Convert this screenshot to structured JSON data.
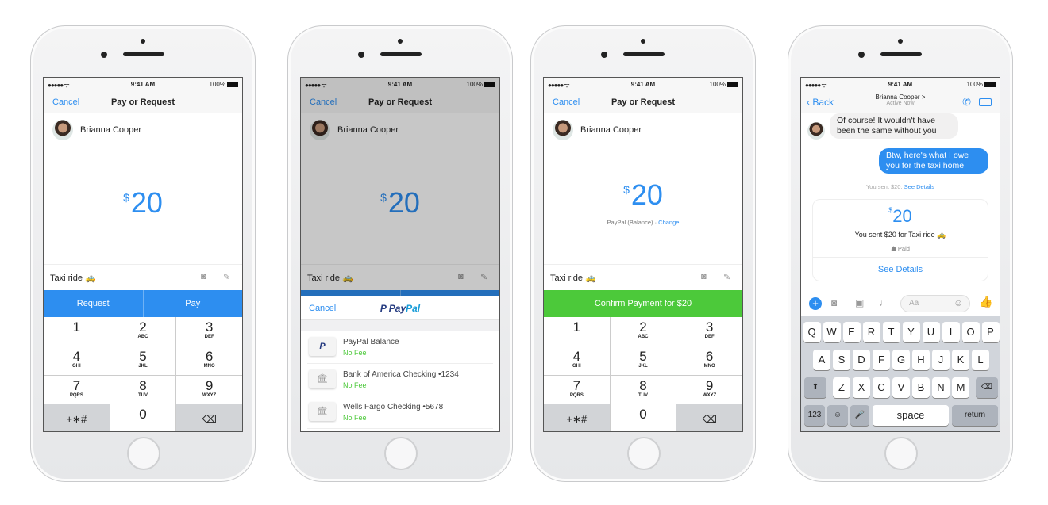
{
  "status": {
    "signal": "●●●●● ᯤ",
    "time": "9:41 AM",
    "battery": "100%"
  },
  "pay": {
    "cancel": "Cancel",
    "title": "Pay or Request",
    "contact": "Brianna Cooper",
    "currency": "$",
    "amount": "20",
    "memo": "Taxi ride 🚕",
    "request": "Request",
    "pay": "Pay",
    "camera_icon": "camera-icon",
    "edit_icon": "edit-icon"
  },
  "keypad": [
    {
      "d": "1",
      "l": ""
    },
    {
      "d": "2",
      "l": "ABC"
    },
    {
      "d": "3",
      "l": "DEF"
    },
    {
      "d": "4",
      "l": "GHI"
    },
    {
      "d": "5",
      "l": "JKL"
    },
    {
      "d": "6",
      "l": "MNO"
    },
    {
      "d": "7",
      "l": "PQRS"
    },
    {
      "d": "8",
      "l": "TUV"
    },
    {
      "d": "9",
      "l": "WXYZ"
    },
    {
      "d": "+∗#",
      "l": "",
      "g": true
    },
    {
      "d": "0",
      "l": ""
    },
    {
      "d": "⌫",
      "l": "",
      "g": true
    }
  ],
  "sheet": {
    "cancel": "Cancel",
    "brand_a": "Pay",
    "brand_b": "Pal",
    "methods": [
      {
        "name": "PayPal Balance",
        "fee": "No Fee",
        "icon": "P"
      },
      {
        "name": "Bank of America Checking •1234",
        "fee": "No Fee",
        "icon": "🏛"
      },
      {
        "name": "Wells Fargo Checking •5678",
        "fee": "No Fee",
        "icon": "🏛"
      }
    ]
  },
  "confirm": {
    "source": "PayPal (Balance) · ",
    "change": "Change",
    "button": "Confirm Payment for $20"
  },
  "chat": {
    "back": "Back",
    "name": "Brianna Cooper >",
    "presence": "Active Now",
    "incoming": "Of course! It wouldn't have been the same without you",
    "outgoing": "Btw, here's what I owe you for the taxi home",
    "sent_note": "You sent $20. ",
    "see_details": "See Details",
    "card_amount": "20",
    "card_desc": "You sent $20 for Taxi ride 🚕",
    "paid": "Paid",
    "card_link": "See Details",
    "composer_placeholder": "Aa"
  },
  "keyboard": {
    "rows": [
      [
        "Q",
        "W",
        "E",
        "R",
        "T",
        "Y",
        "U",
        "I",
        "O",
        "P"
      ],
      [
        "A",
        "S",
        "D",
        "F",
        "G",
        "H",
        "J",
        "K",
        "L"
      ],
      [
        "Z",
        "X",
        "C",
        "V",
        "B",
        "N",
        "M"
      ]
    ],
    "shift": "⬆",
    "delete": "⌫",
    "numbers": "123",
    "emoji": "☺",
    "mic": "🎤",
    "space": "space",
    "return": "return"
  },
  "colors": {
    "accent": "#2d8ef0",
    "confirm": "#4cc93a"
  }
}
